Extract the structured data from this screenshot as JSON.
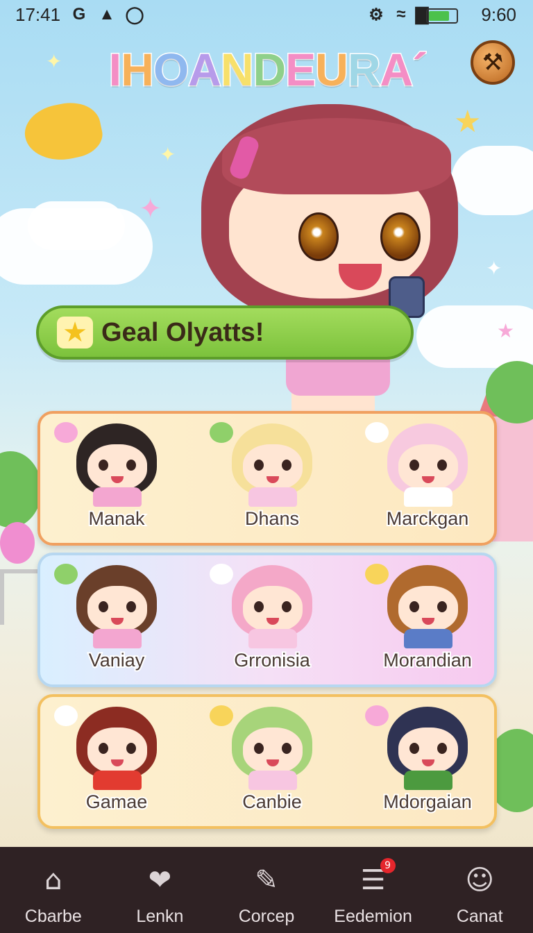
{
  "status_bar": {
    "time_left": "17:41",
    "time_right": "9:60",
    "icons": [
      "g-icon",
      "triangle-icon",
      "shield-icon",
      "mute-icon",
      "wifi-icon",
      "signal-icon",
      "battery-icon"
    ]
  },
  "header": {
    "title": "IHOANDEURA",
    "title_suffix": "´",
    "title_colors": [
      "#f48ec5",
      "#f7b15a",
      "#8fb8ef",
      "#b79bea",
      "#f7e06a",
      "#8fd08a",
      "#f48ec5",
      "#f7b15a",
      "#9fd7e6",
      "#f48ec5"
    ],
    "settings_icon": "wrench-icon"
  },
  "banner": {
    "text": "Geal Olyatts!",
    "icon": "star-icon"
  },
  "characters": {
    "row1": [
      {
        "name": "Manak",
        "hair": "#2e2524",
        "shirt": "#f3a6d0"
      },
      {
        "name": "Dhans",
        "hair": "#f6e09a",
        "shirt": "#f7c6e1"
      },
      {
        "name": "Marckgan",
        "hair": "#f7c9df",
        "shirt": "#ffffff"
      }
    ],
    "row2": [
      {
        "name": "Vaniay",
        "hair": "#6a3f2a",
        "shirt": "#f3a6d0"
      },
      {
        "name": "Grronisia",
        "hair": "#f4a8c8",
        "shirt": "#f7c6e1"
      },
      {
        "name": "Morandian",
        "hair": "#b06a2e",
        "shirt": "#5a7cc7"
      }
    ],
    "row3": [
      {
        "name": "Gamae",
        "hair": "#8c2c22",
        "shirt": "#e23b30"
      },
      {
        "name": "Canbie",
        "hair": "#a7d47a",
        "shirt": "#f7c6e1"
      },
      {
        "name": "Mdorgaian",
        "hair": "#2f3353",
        "shirt": "#4c9a3f"
      }
    ]
  },
  "nav": [
    {
      "label": "Cbarbe",
      "icon": "home-icon",
      "glyph": "⌂"
    },
    {
      "label": "Lenkn",
      "icon": "heart-icon",
      "glyph": "❤"
    },
    {
      "label": "Corcep",
      "icon": "pencil-icon",
      "glyph": "✎"
    },
    {
      "label": "Eedemion",
      "icon": "notes-icon",
      "glyph": "☰",
      "badge": "9"
    },
    {
      "label": "Canat",
      "icon": "profile-icon",
      "glyph": "☺"
    }
  ]
}
